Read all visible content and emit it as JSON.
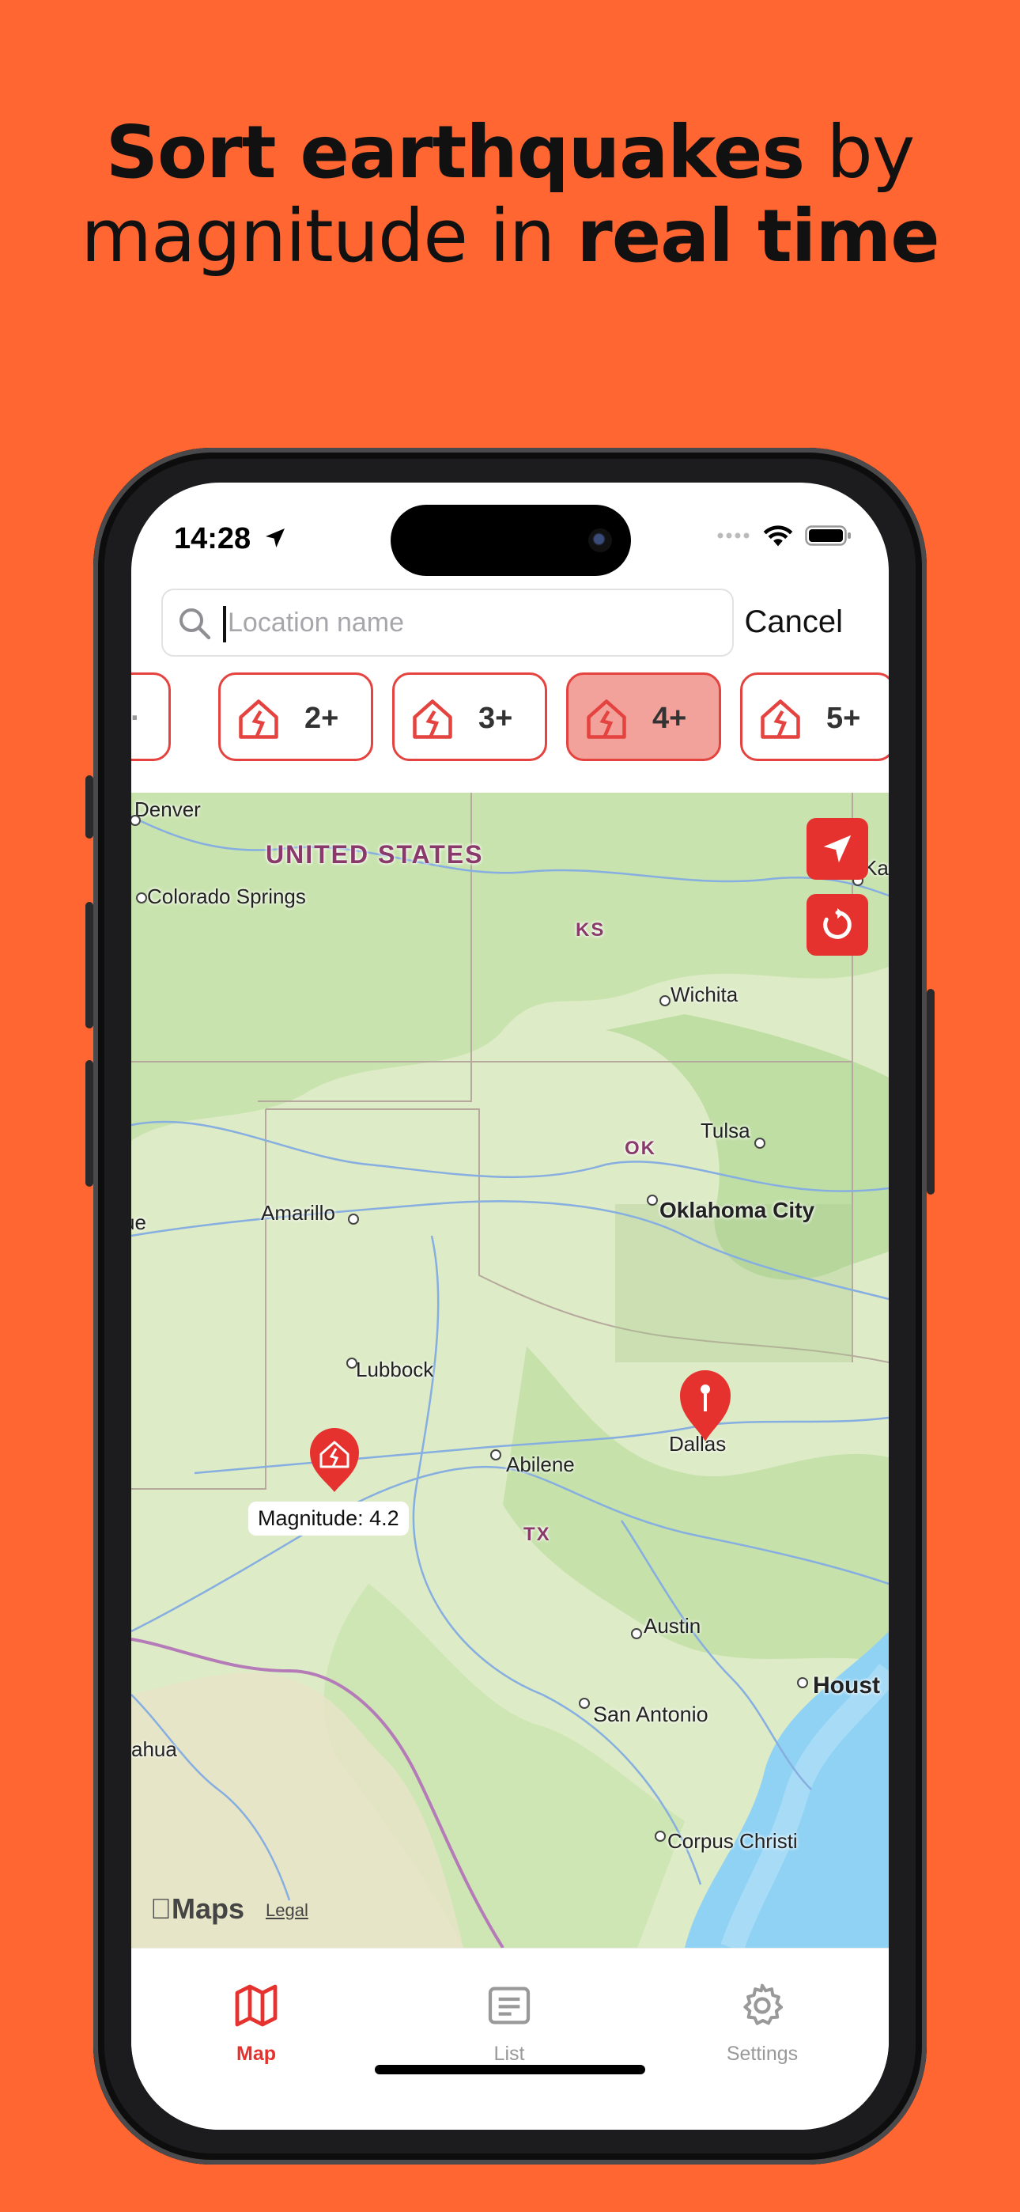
{
  "headline": {
    "part1_bold": "Sort earthquakes",
    "part2": " by",
    "part3": "magnitude in ",
    "part4_bold": "real time"
  },
  "status_bar": {
    "time": "14:28"
  },
  "search": {
    "placeholder": "Location name",
    "value": "",
    "cancel_label": "Cancel"
  },
  "filters": [
    {
      "label": "2+",
      "active": false
    },
    {
      "label": "3+",
      "active": false
    },
    {
      "label": "4+",
      "active": true
    },
    {
      "label": "5+",
      "active": false
    }
  ],
  "map": {
    "region_labels": [
      "UNITED STATES",
      "KS",
      "OK",
      "TX"
    ],
    "cities": [
      "Denver",
      "Colorado Springs",
      "Wichita",
      "Tulsa",
      "Amarillo",
      "Oklahoma City",
      "Lubbock",
      "Dallas",
      "Abilene",
      "Austin",
      "San Antonio",
      "Houst",
      "Corpus Christi",
      "ahua",
      "ue",
      "Ka"
    ],
    "earthquake_marker_label": "Magnitude: 4.2",
    "attribution": "Maps",
    "legal_link": "Legal"
  },
  "tabs": [
    {
      "label": "Map",
      "icon": "map-icon",
      "active": true
    },
    {
      "label": "List",
      "icon": "list-icon",
      "active": false
    },
    {
      "label": "Settings",
      "icon": "gear-icon",
      "active": false
    }
  ],
  "colors": {
    "background": "#FF6632",
    "accent": "#E5322E",
    "chip_active": "#F2A29B"
  }
}
